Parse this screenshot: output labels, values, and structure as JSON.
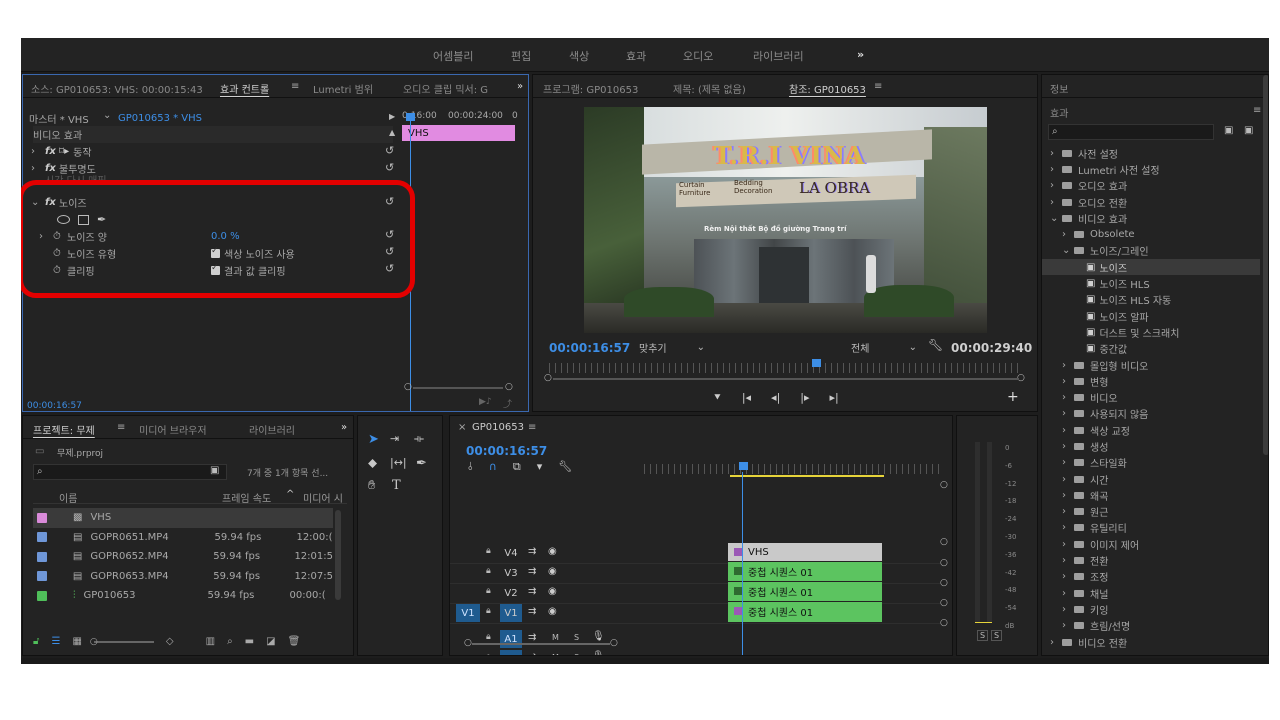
{
  "workspace_tabs": [
    "어셈블리",
    "편집",
    "색상",
    "효과",
    "오디오",
    "라이브러리",
    "»"
  ],
  "effect_controls": {
    "tabs": [
      "소스: GP010653: VHS: 00:00:15:43",
      "효과 컨트롤",
      "Lumetri 범위",
      "오디오 클립 믹서: G",
      "»"
    ],
    "master_label": "마스터 * VHS",
    "sequence_label": "GP010653 * VHS",
    "ruler_times": [
      "0:16:00",
      "00:00:24:00",
      "0"
    ],
    "clip_label": "VHS",
    "section_video_effects": "비디오 효과",
    "fx_motion": "동작",
    "fx_opacity": "불투명도",
    "fx_time_remap": "시간 다시 매핑",
    "fx_noise": "노이즈",
    "prop_amount": "노이즈 양",
    "prop_amount_value": "0.0 %",
    "prop_type": "노이즈 유형",
    "prop_type_value": "색상 노이즈 사용",
    "prop_clip": "클리핑",
    "prop_clip_value": "결과 값 클리핑",
    "timecode": "00:00:16:57"
  },
  "program_monitor": {
    "tabs": [
      "프로그램: GP010653",
      "제목: (제목 없음)",
      "참조: GP010653"
    ],
    "timecode": "00:00:16:57",
    "fit": "맞추기",
    "quality": "전체",
    "duration": "00:00:29:40",
    "sign_main": "T.R.I VINA",
    "sign_sub1": "LA OBRA",
    "sign_sub2": "Curtain Furniture",
    "sign_sub3": "Bedding Decoration",
    "sign_banner": "Rèm  Nội thất  Bộ đồ giường  Trang trí"
  },
  "effects_panel": {
    "info_tab": "정보",
    "effects_tab": "효과",
    "tree": [
      {
        "label": "사전 설정",
        "level": 0,
        "type": "folder"
      },
      {
        "label": "Lumetri 사전 설정",
        "level": 0,
        "type": "folder"
      },
      {
        "label": "오디오 효과",
        "level": 0,
        "type": "folder"
      },
      {
        "label": "오디오 전환",
        "level": 0,
        "type": "folder"
      },
      {
        "label": "비디오 효과",
        "level": 0,
        "type": "folder-open"
      },
      {
        "label": "Obsolete",
        "level": 1,
        "type": "folder"
      },
      {
        "label": "노이즈/그레인",
        "level": 1,
        "type": "folder-open"
      },
      {
        "label": "노이즈",
        "level": 2,
        "type": "fx",
        "selected": true
      },
      {
        "label": "노이즈 HLS",
        "level": 2,
        "type": "fx"
      },
      {
        "label": "노이즈 HLS 자동",
        "level": 2,
        "type": "fx"
      },
      {
        "label": "노이즈 알파",
        "level": 2,
        "type": "fx"
      },
      {
        "label": "더스트 및 스크래치",
        "level": 2,
        "type": "fx"
      },
      {
        "label": "중간값",
        "level": 2,
        "type": "fx"
      },
      {
        "label": "몰입형 비디오",
        "level": 1,
        "type": "folder"
      },
      {
        "label": "변형",
        "level": 1,
        "type": "folder"
      },
      {
        "label": "비디오",
        "level": 1,
        "type": "folder"
      },
      {
        "label": "사용되지 않음",
        "level": 1,
        "type": "folder"
      },
      {
        "label": "색상 교정",
        "level": 1,
        "type": "folder"
      },
      {
        "label": "생성",
        "level": 1,
        "type": "folder"
      },
      {
        "label": "스타일화",
        "level": 1,
        "type": "folder"
      },
      {
        "label": "시간",
        "level": 1,
        "type": "folder"
      },
      {
        "label": "왜곡",
        "level": 1,
        "type": "folder"
      },
      {
        "label": "원근",
        "level": 1,
        "type": "folder"
      },
      {
        "label": "유틸리티",
        "level": 1,
        "type": "folder"
      },
      {
        "label": "이미지 제어",
        "level": 1,
        "type": "folder"
      },
      {
        "label": "전환",
        "level": 1,
        "type": "folder"
      },
      {
        "label": "조정",
        "level": 1,
        "type": "folder"
      },
      {
        "label": "채널",
        "level": 1,
        "type": "folder"
      },
      {
        "label": "키잉",
        "level": 1,
        "type": "folder"
      },
      {
        "label": "흐림/선명",
        "level": 1,
        "type": "folder"
      },
      {
        "label": "비디오 전환",
        "level": 0,
        "type": "folder"
      }
    ]
  },
  "project_panel": {
    "tabs": [
      "프로젝트: 무제",
      "미디어 브라우저",
      "라이브러리",
      "»"
    ],
    "file_name": "무제.prproj",
    "count": "7개 중 1개 항목 선...",
    "columns": [
      "이름",
      "프레임 속도",
      "미디어 시"
    ],
    "items": [
      {
        "name": "VHS",
        "fps": "",
        "start": "",
        "color": "#d98ad9",
        "selected": true
      },
      {
        "name": "GOPR0651.MP4",
        "fps": "59.94 fps",
        "start": "12:00:(",
        "color": "#6f97d8"
      },
      {
        "name": "GOPR0652.MP4",
        "fps": "59.94 fps",
        "start": "12:01:5",
        "color": "#6f97d8"
      },
      {
        "name": "GOPR0653.MP4",
        "fps": "59.94 fps",
        "start": "12:07:5",
        "color": "#6f97d8"
      },
      {
        "name": "GP010653",
        "fps": "59.94 fps",
        "start": "00:00:(",
        "color": "#4fbf5a"
      }
    ]
  },
  "timeline": {
    "tab": "GP010653",
    "timecode": "00:00:16:57",
    "tracks_video": [
      "V4",
      "V3",
      "V2",
      "V1"
    ],
    "tracks_audio": [
      "A1",
      "A2"
    ],
    "source_patch": "V1",
    "clips": [
      {
        "label": "VHS",
        "track": "V4",
        "color": "#c9c9c9"
      },
      {
        "label": "중첩 시퀀스 01",
        "track": "V3",
        "color": "#5cc460"
      },
      {
        "label": "중첩 시퀀스 01",
        "track": "V2",
        "color": "#5cc460"
      },
      {
        "label": "중첩 시퀀스 01",
        "track": "V1",
        "color": "#5cc460"
      }
    ],
    "m_label": "M",
    "s_label": "S"
  },
  "audio_meter": {
    "scale": [
      "0",
      "-6",
      "-12",
      "-18",
      "-24",
      "-30",
      "-36",
      "-42",
      "-48",
      "-54",
      "dB"
    ],
    "solo": [
      "S",
      "S"
    ]
  },
  "colors": {
    "accent": "#3d8ee6",
    "highlight_circle": "#e30000",
    "playhead": "#3d8ee6",
    "in_out": "#e6d43a"
  }
}
